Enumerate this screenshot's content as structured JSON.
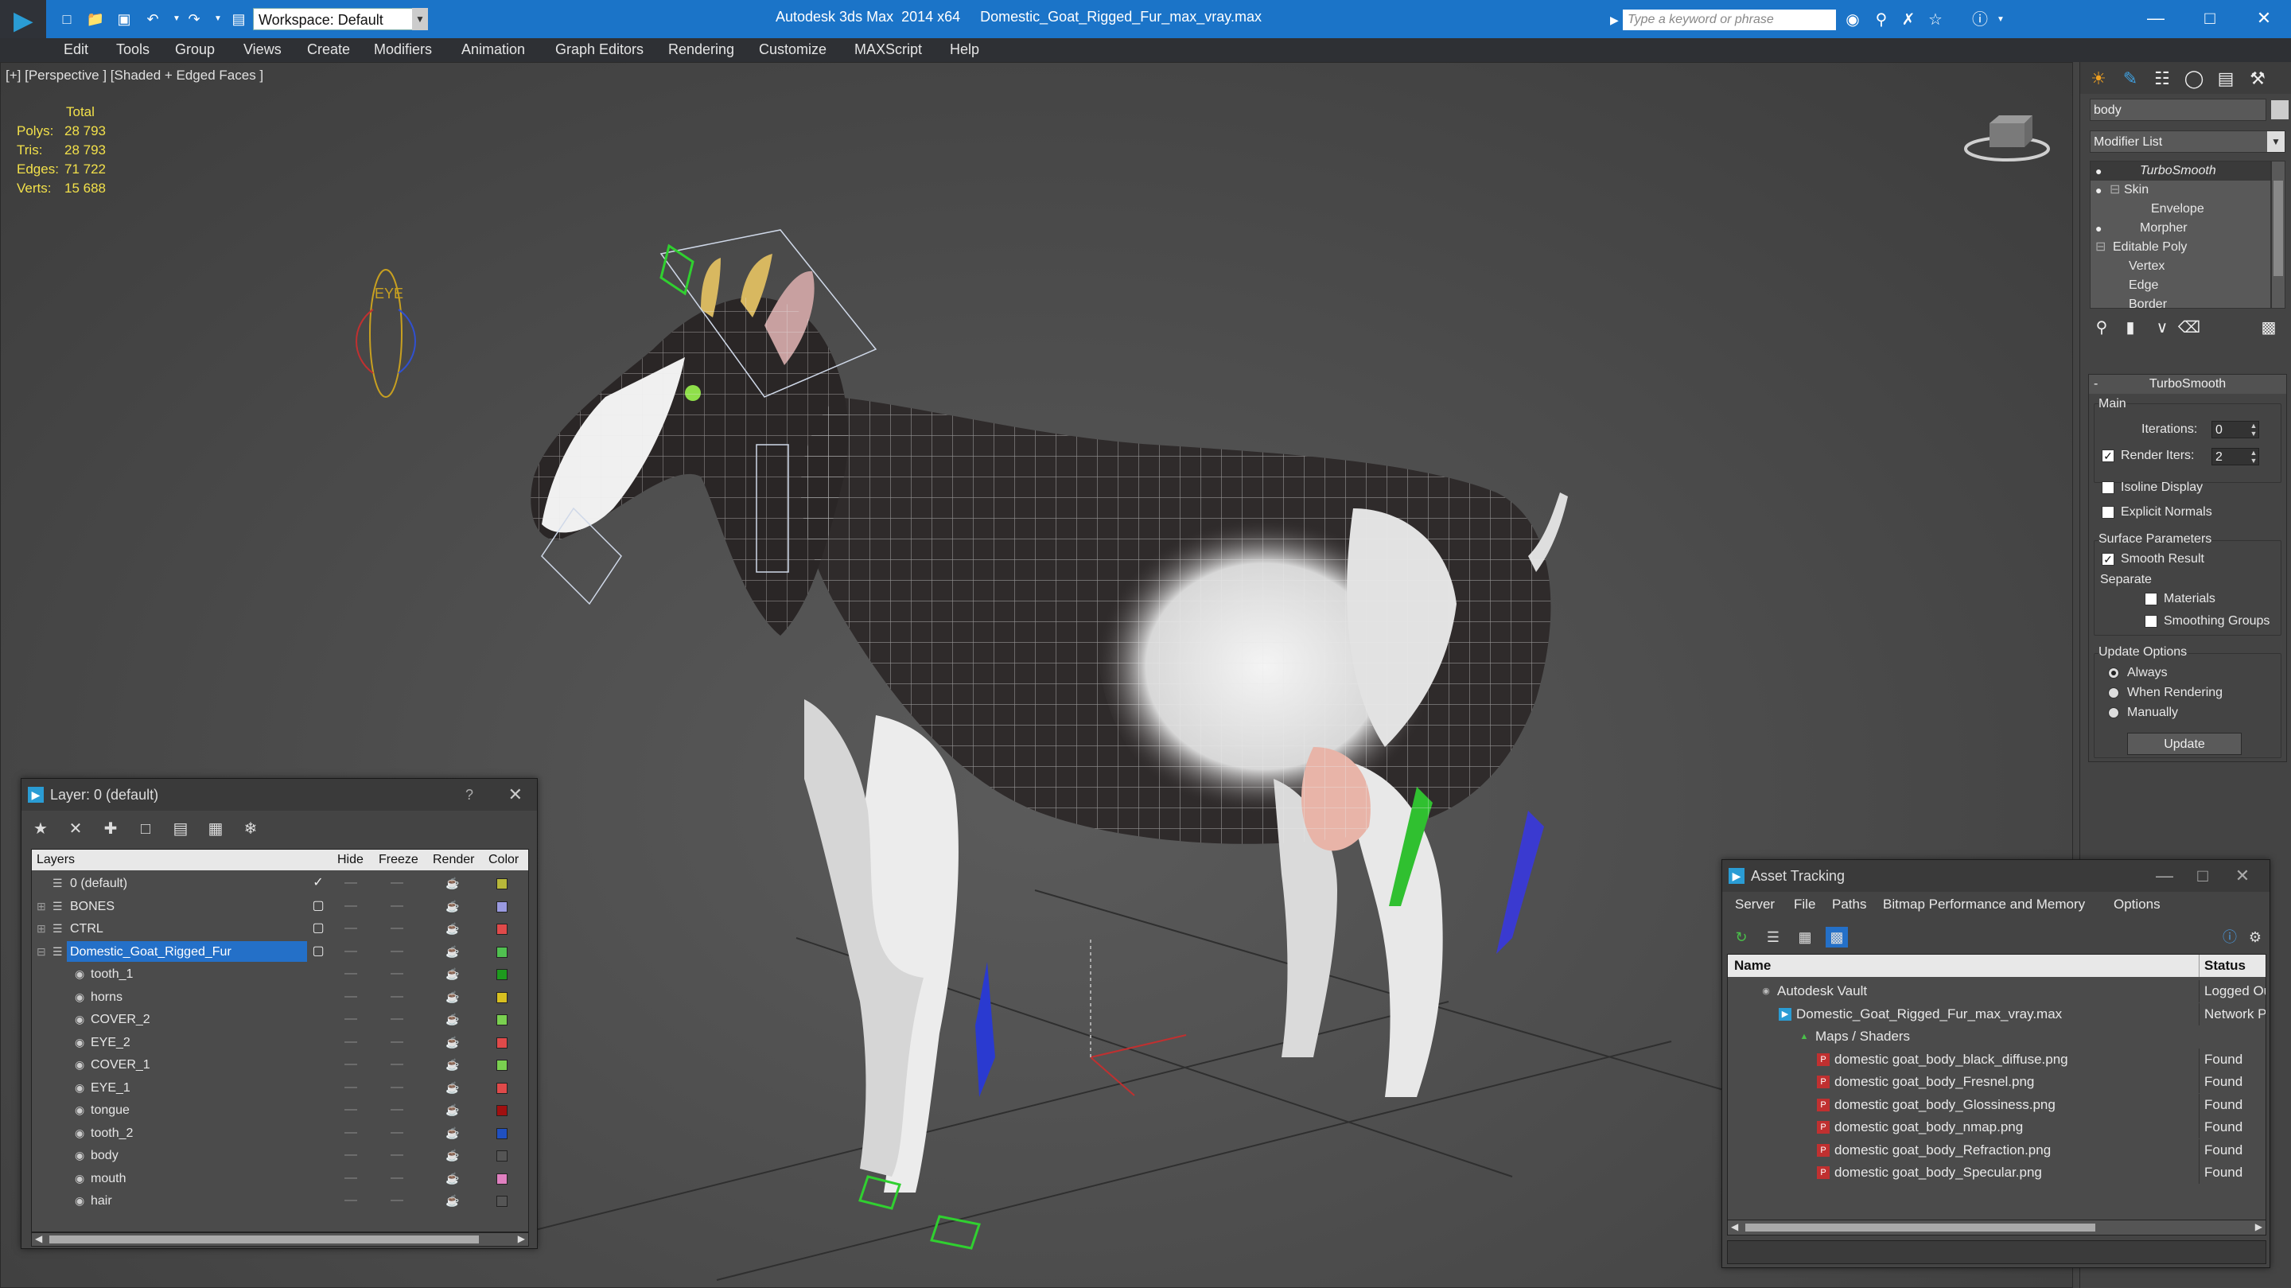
{
  "titlebar": {
    "workspace_label": "Workspace: Default",
    "title": "Autodesk 3ds Max  2014 x64     Domestic_Goat_Rigged_Fur_max_vray.max",
    "search_placeholder": "Type a keyword or phrase",
    "accent": "#1b74c8"
  },
  "menu": [
    "Edit",
    "Tools",
    "Group",
    "Views",
    "Create",
    "Modifiers",
    "Animation",
    "Graph Editors",
    "Rendering",
    "Customize",
    "MAXScript",
    "Help"
  ],
  "viewport": {
    "label": "[+] [Perspective ] [Shaded + Edged Faces ]",
    "stats": {
      "header": "Total",
      "rows": [
        {
          "key": "Polys:",
          "value": "28 793"
        },
        {
          "key": "Tris:",
          "value": "28 793"
        },
        {
          "key": "Edges:",
          "value": "71 722"
        },
        {
          "key": "Verts:",
          "value": "15 688"
        }
      ]
    },
    "eye_label": "EYE"
  },
  "command_panel": {
    "object_name": "body",
    "modifier_list": "Modifier List",
    "stack": [
      "TurboSmooth",
      "Skin",
      "Envelope",
      "Morpher",
      "Editable Poly",
      "Vertex",
      "Edge",
      "Border"
    ],
    "turbosmooth": {
      "title": "TurboSmooth",
      "main": "Main",
      "iterations_label": "Iterations:",
      "iterations_value": "0",
      "render_iters_label": "Render Iters:",
      "render_iters_value": "2",
      "isoline": "Isoline Display",
      "explicit_normals": "Explicit Normals",
      "surface_params": "Surface Parameters",
      "smooth_result": "Smooth Result",
      "separate": "Separate",
      "materials": "Materials",
      "smoothing_groups": "Smoothing Groups",
      "update_options": "Update Options",
      "always": "Always",
      "when_rendering": "When Rendering",
      "manually": "Manually",
      "update_btn": "Update"
    }
  },
  "layer_dialog": {
    "title": "Layer: 0 (default)",
    "help": "?",
    "columns": [
      "Layers",
      "Hide",
      "Freeze",
      "Render",
      "Color"
    ],
    "rows": [
      {
        "name": "0 (default)",
        "color": "#b8b83a"
      },
      {
        "name": "BONES",
        "color": "#9a9ae0"
      },
      {
        "name": "CTRL",
        "color": "#e04a4a"
      },
      {
        "name": "Domestic_Goat_Rigged_Fur",
        "color": "#50c050"
      },
      {
        "name": "tooth_1",
        "color": "#1e9a1e"
      },
      {
        "name": "horns",
        "color": "#d8c020"
      },
      {
        "name": "COVER_2",
        "color": "#7ad050"
      },
      {
        "name": "EYE_2",
        "color": "#e04a4a"
      },
      {
        "name": "COVER_1",
        "color": "#7ad050"
      },
      {
        "name": "EYE_1",
        "color": "#e04a4a"
      },
      {
        "name": "tongue",
        "color": "#a01010"
      },
      {
        "name": "tooth_2",
        "color": "#2050c0"
      },
      {
        "name": "body",
        "color": "#555555"
      },
      {
        "name": "mouth",
        "color": "#e080c0"
      },
      {
        "name": "hair",
        "color": "#555555"
      }
    ]
  },
  "asset_dialog": {
    "title": "Asset Tracking",
    "menu": [
      "Server",
      "File",
      "Paths",
      "Bitmap Performance and Memory",
      "Options"
    ],
    "col_name": "Name",
    "col_status": "Status",
    "rows": [
      {
        "name": "Autodesk Vault",
        "status": "Logged Ou"
      },
      {
        "name": "Domestic_Goat_Rigged_Fur_max_vray.max",
        "status": "Network P"
      },
      {
        "name": "Maps / Shaders",
        "status": ""
      },
      {
        "name": "domestic goat_body_black_diffuse.png",
        "status": "Found"
      },
      {
        "name": "domestic goat_body_Fresnel.png",
        "status": "Found"
      },
      {
        "name": "domestic goat_body_Glossiness.png",
        "status": "Found"
      },
      {
        "name": "domestic goat_body_nmap.png",
        "status": "Found"
      },
      {
        "name": "domestic goat_body_Refraction.png",
        "status": "Found"
      },
      {
        "name": "domestic goat_body_Specular.png",
        "status": "Found"
      }
    ]
  }
}
